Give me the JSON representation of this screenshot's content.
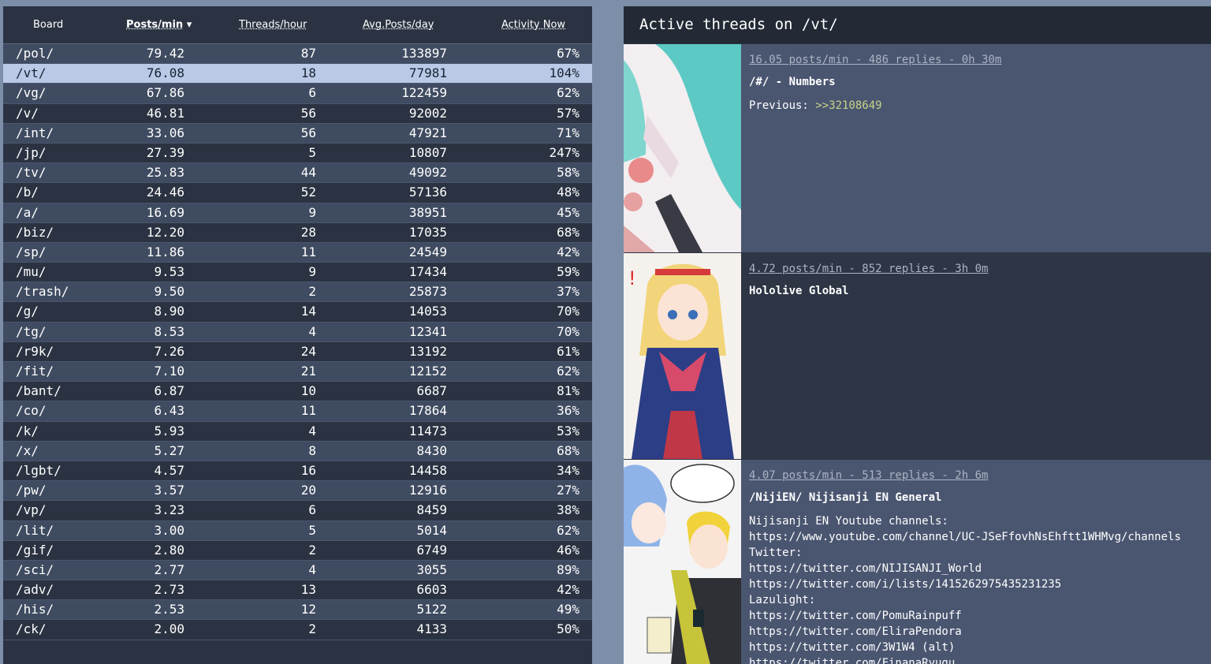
{
  "table": {
    "headers": {
      "board": "Board",
      "posts_per_min": "Posts/min",
      "threads_per_hour": "Threads/hour",
      "avg_posts_per_day": "Avg.Posts/day",
      "activity_now": "Activity Now"
    },
    "sort_indicator": "▾",
    "rows": [
      {
        "board": "/pol/",
        "ppm": "79.42",
        "tph": "87",
        "apd": "133897",
        "act": "67%"
      },
      {
        "board": "/vt/",
        "ppm": "76.08",
        "tph": "18",
        "apd": "77981",
        "act": "104%"
      },
      {
        "board": "/vg/",
        "ppm": "67.86",
        "tph": "6",
        "apd": "122459",
        "act": "62%"
      },
      {
        "board": "/v/",
        "ppm": "46.81",
        "tph": "56",
        "apd": "92002",
        "act": "57%"
      },
      {
        "board": "/int/",
        "ppm": "33.06",
        "tph": "56",
        "apd": "47921",
        "act": "71%"
      },
      {
        "board": "/jp/",
        "ppm": "27.39",
        "tph": "5",
        "apd": "10807",
        "act": "247%"
      },
      {
        "board": "/tv/",
        "ppm": "25.83",
        "tph": "44",
        "apd": "49092",
        "act": "58%"
      },
      {
        "board": "/b/",
        "ppm": "24.46",
        "tph": "52",
        "apd": "57136",
        "act": "48%"
      },
      {
        "board": "/a/",
        "ppm": "16.69",
        "tph": "9",
        "apd": "38951",
        "act": "45%"
      },
      {
        "board": "/biz/",
        "ppm": "12.20",
        "tph": "28",
        "apd": "17035",
        "act": "68%"
      },
      {
        "board": "/sp/",
        "ppm": "11.86",
        "tph": "11",
        "apd": "24549",
        "act": "42%"
      },
      {
        "board": "/mu/",
        "ppm": "9.53",
        "tph": "9",
        "apd": "17434",
        "act": "59%"
      },
      {
        "board": "/trash/",
        "ppm": "9.50",
        "tph": "2",
        "apd": "25873",
        "act": "37%"
      },
      {
        "board": "/g/",
        "ppm": "8.90",
        "tph": "14",
        "apd": "14053",
        "act": "70%"
      },
      {
        "board": "/tg/",
        "ppm": "8.53",
        "tph": "4",
        "apd": "12341",
        "act": "70%"
      },
      {
        "board": "/r9k/",
        "ppm": "7.26",
        "tph": "24",
        "apd": "13192",
        "act": "61%"
      },
      {
        "board": "/fit/",
        "ppm": "7.10",
        "tph": "21",
        "apd": "12152",
        "act": "62%"
      },
      {
        "board": "/bant/",
        "ppm": "6.87",
        "tph": "10",
        "apd": "6687",
        "act": "81%"
      },
      {
        "board": "/co/",
        "ppm": "6.43",
        "tph": "11",
        "apd": "17864",
        "act": "36%"
      },
      {
        "board": "/k/",
        "ppm": "5.93",
        "tph": "4",
        "apd": "11473",
        "act": "53%"
      },
      {
        "board": "/x/",
        "ppm": "5.27",
        "tph": "8",
        "apd": "8430",
        "act": "68%"
      },
      {
        "board": "/lgbt/",
        "ppm": "4.57",
        "tph": "16",
        "apd": "14458",
        "act": "34%"
      },
      {
        "board": "/pw/",
        "ppm": "3.57",
        "tph": "20",
        "apd": "12916",
        "act": "27%"
      },
      {
        "board": "/vp/",
        "ppm": "3.23",
        "tph": "6",
        "apd": "8459",
        "act": "38%"
      },
      {
        "board": "/lit/",
        "ppm": "3.00",
        "tph": "5",
        "apd": "5014",
        "act": "62%"
      },
      {
        "board": "/gif/",
        "ppm": "2.80",
        "tph": "2",
        "apd": "6749",
        "act": "46%"
      },
      {
        "board": "/sci/",
        "ppm": "2.77",
        "tph": "4",
        "apd": "3055",
        "act": "89%"
      },
      {
        "board": "/adv/",
        "ppm": "2.73",
        "tph": "13",
        "apd": "6603",
        "act": "42%"
      },
      {
        "board": "/his/",
        "ppm": "2.53",
        "tph": "12",
        "apd": "5122",
        "act": "49%"
      },
      {
        "board": "/ck/",
        "ppm": "2.00",
        "tph": "2",
        "apd": "4133",
        "act": "50%"
      }
    ]
  },
  "threads": {
    "title": "Active threads on /vt/",
    "items": [
      {
        "meta": "16.05 posts/min - 486 replies - 0h 30m",
        "subject": "/#/ - Numbers",
        "text_prefix": "Previous: ",
        "quotelink": ">>32108649"
      },
      {
        "meta": "4.72 posts/min - 852 replies - 3h 0m",
        "subject": "Hololive Global",
        "text_prefix": "",
        "quotelink": ""
      },
      {
        "meta": "4.07 posts/min - 513 replies - 2h 6m",
        "subject": "/NijiEN/ Nijisanji EN General",
        "text_prefix": "Nijisanji EN Youtube channels:\nhttps://www.youtube.com/channel/UC-JSeFfovhNsEhftt1WHMvg/channels\nTwitter:\nhttps://twitter.com/NIJISANJI_World\nhttps://twitter.com/i/lists/1415262975435231235\nLazulight:\nhttps://twitter.com/PomuRainpuff\nhttps://twitter.com/EliraPendora\nhttps://twitter.com/3W1W4 (alt)\nhttps://twitter.com/FinanaRyugu",
        "quotelink": ""
      }
    ]
  },
  "colors": {
    "page_bg": "#7c8ea8",
    "panel_bg": "#2b3342",
    "row_alt": "#3f4b60",
    "row_selected": "#b9c9e6",
    "quotelink": "#c7d38a"
  }
}
